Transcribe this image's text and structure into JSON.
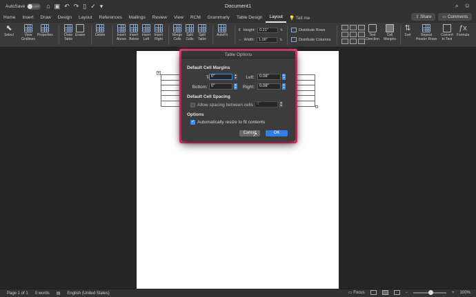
{
  "titlebar": {
    "autosave_label": "AutoSave",
    "autosave_state": "OFF",
    "doc_title": "Document1"
  },
  "tabs": [
    "Home",
    "Insert",
    "Draw",
    "Design",
    "Layout",
    "References",
    "Mailings",
    "Review",
    "View",
    "RCM",
    "Grammarly",
    "Table Design",
    "Layout"
  ],
  "active_tab_index": 12,
  "tell_me": "Tell me",
  "share_label": "Share",
  "comments_label": "Comments",
  "ribbon": {
    "select": "Select",
    "view_gridlines": "View Gridlines",
    "properties": "Properties",
    "draw_table": "Draw Table",
    "eraser": "Eraser",
    "delete": "Delete",
    "insert_above": "Insert Above",
    "insert_below": "Insert Below",
    "insert_left": "Insert Left",
    "insert_right": "Insert Right",
    "merge_cells": "Merge Cells",
    "split_cells": "Split Cells",
    "split_table": "Split Table",
    "autofit": "AutoFit",
    "height_label": "Height:",
    "height_value": "0.21\"",
    "width_label": "Width:",
    "width_value": "1.08\"",
    "distribute_rows": "Distribute Rows",
    "distribute_columns": "Distribute Columns",
    "text_direction": "Text Direction",
    "cell_margins": "Cell Margins",
    "sort": "Sort",
    "repeat_header_rows": "Repeat Header Rows",
    "convert_to_text": "Convert to Text",
    "formula": "Formula"
  },
  "dialog": {
    "title": "Table Options",
    "margins_heading": "Default Cell Margins",
    "top_label": "Top:",
    "top_value": "0\"",
    "left_label": "Left:",
    "left_value": "0.08\"",
    "bottom_label": "Bottom:",
    "bottom_value": "0\"",
    "right_label": "Right:",
    "right_value": "0.08\"",
    "spacing_heading": "Default Cell Spacing",
    "allow_spacing_label": "Allow spacing between cells",
    "allow_spacing_checked": false,
    "spacing_value": "0\"",
    "options_heading": "Options",
    "auto_resize_label": "Automatically resize to fit contents",
    "auto_resize_checked": true,
    "cancel_label": "Cancel",
    "ok_label": "OK"
  },
  "statusbar": {
    "page": "Page 1 of 1",
    "words": "0 words",
    "language": "English (United States)",
    "focus": "Focus",
    "zoom": "100%"
  },
  "colors": {
    "highlight": "#e2457a",
    "accent": "#2f7fe6"
  }
}
